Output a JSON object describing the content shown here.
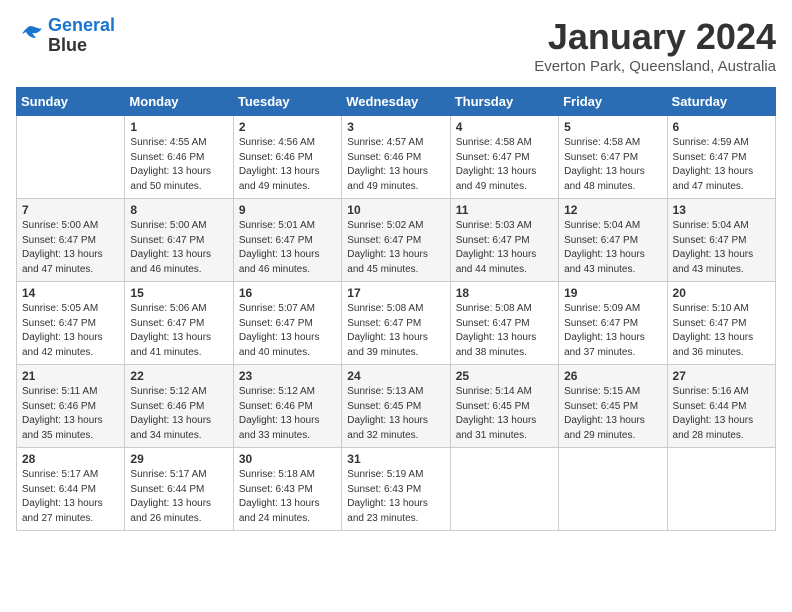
{
  "header": {
    "logo_line1": "General",
    "logo_line2": "Blue",
    "month": "January 2024",
    "location": "Everton Park, Queensland, Australia"
  },
  "days_of_week": [
    "Sunday",
    "Monday",
    "Tuesday",
    "Wednesday",
    "Thursday",
    "Friday",
    "Saturday"
  ],
  "weeks": [
    [
      {
        "num": "",
        "info": ""
      },
      {
        "num": "1",
        "info": "Sunrise: 4:55 AM\nSunset: 6:46 PM\nDaylight: 13 hours\nand 50 minutes."
      },
      {
        "num": "2",
        "info": "Sunrise: 4:56 AM\nSunset: 6:46 PM\nDaylight: 13 hours\nand 49 minutes."
      },
      {
        "num": "3",
        "info": "Sunrise: 4:57 AM\nSunset: 6:46 PM\nDaylight: 13 hours\nand 49 minutes."
      },
      {
        "num": "4",
        "info": "Sunrise: 4:58 AM\nSunset: 6:47 PM\nDaylight: 13 hours\nand 49 minutes."
      },
      {
        "num": "5",
        "info": "Sunrise: 4:58 AM\nSunset: 6:47 PM\nDaylight: 13 hours\nand 48 minutes."
      },
      {
        "num": "6",
        "info": "Sunrise: 4:59 AM\nSunset: 6:47 PM\nDaylight: 13 hours\nand 47 minutes."
      }
    ],
    [
      {
        "num": "7",
        "info": "Sunrise: 5:00 AM\nSunset: 6:47 PM\nDaylight: 13 hours\nand 47 minutes."
      },
      {
        "num": "8",
        "info": "Sunrise: 5:00 AM\nSunset: 6:47 PM\nDaylight: 13 hours\nand 46 minutes."
      },
      {
        "num": "9",
        "info": "Sunrise: 5:01 AM\nSunset: 6:47 PM\nDaylight: 13 hours\nand 46 minutes."
      },
      {
        "num": "10",
        "info": "Sunrise: 5:02 AM\nSunset: 6:47 PM\nDaylight: 13 hours\nand 45 minutes."
      },
      {
        "num": "11",
        "info": "Sunrise: 5:03 AM\nSunset: 6:47 PM\nDaylight: 13 hours\nand 44 minutes."
      },
      {
        "num": "12",
        "info": "Sunrise: 5:04 AM\nSunset: 6:47 PM\nDaylight: 13 hours\nand 43 minutes."
      },
      {
        "num": "13",
        "info": "Sunrise: 5:04 AM\nSunset: 6:47 PM\nDaylight: 13 hours\nand 43 minutes."
      }
    ],
    [
      {
        "num": "14",
        "info": "Sunrise: 5:05 AM\nSunset: 6:47 PM\nDaylight: 13 hours\nand 42 minutes."
      },
      {
        "num": "15",
        "info": "Sunrise: 5:06 AM\nSunset: 6:47 PM\nDaylight: 13 hours\nand 41 minutes."
      },
      {
        "num": "16",
        "info": "Sunrise: 5:07 AM\nSunset: 6:47 PM\nDaylight: 13 hours\nand 40 minutes."
      },
      {
        "num": "17",
        "info": "Sunrise: 5:08 AM\nSunset: 6:47 PM\nDaylight: 13 hours\nand 39 minutes."
      },
      {
        "num": "18",
        "info": "Sunrise: 5:08 AM\nSunset: 6:47 PM\nDaylight: 13 hours\nand 38 minutes."
      },
      {
        "num": "19",
        "info": "Sunrise: 5:09 AM\nSunset: 6:47 PM\nDaylight: 13 hours\nand 37 minutes."
      },
      {
        "num": "20",
        "info": "Sunrise: 5:10 AM\nSunset: 6:47 PM\nDaylight: 13 hours\nand 36 minutes."
      }
    ],
    [
      {
        "num": "21",
        "info": "Sunrise: 5:11 AM\nSunset: 6:46 PM\nDaylight: 13 hours\nand 35 minutes."
      },
      {
        "num": "22",
        "info": "Sunrise: 5:12 AM\nSunset: 6:46 PM\nDaylight: 13 hours\nand 34 minutes."
      },
      {
        "num": "23",
        "info": "Sunrise: 5:12 AM\nSunset: 6:46 PM\nDaylight: 13 hours\nand 33 minutes."
      },
      {
        "num": "24",
        "info": "Sunrise: 5:13 AM\nSunset: 6:45 PM\nDaylight: 13 hours\nand 32 minutes."
      },
      {
        "num": "25",
        "info": "Sunrise: 5:14 AM\nSunset: 6:45 PM\nDaylight: 13 hours\nand 31 minutes."
      },
      {
        "num": "26",
        "info": "Sunrise: 5:15 AM\nSunset: 6:45 PM\nDaylight: 13 hours\nand 29 minutes."
      },
      {
        "num": "27",
        "info": "Sunrise: 5:16 AM\nSunset: 6:44 PM\nDaylight: 13 hours\nand 28 minutes."
      }
    ],
    [
      {
        "num": "28",
        "info": "Sunrise: 5:17 AM\nSunset: 6:44 PM\nDaylight: 13 hours\nand 27 minutes."
      },
      {
        "num": "29",
        "info": "Sunrise: 5:17 AM\nSunset: 6:44 PM\nDaylight: 13 hours\nand 26 minutes."
      },
      {
        "num": "30",
        "info": "Sunrise: 5:18 AM\nSunset: 6:43 PM\nDaylight: 13 hours\nand 24 minutes."
      },
      {
        "num": "31",
        "info": "Sunrise: 5:19 AM\nSunset: 6:43 PM\nDaylight: 13 hours\nand 23 minutes."
      },
      {
        "num": "",
        "info": ""
      },
      {
        "num": "",
        "info": ""
      },
      {
        "num": "",
        "info": ""
      }
    ]
  ]
}
